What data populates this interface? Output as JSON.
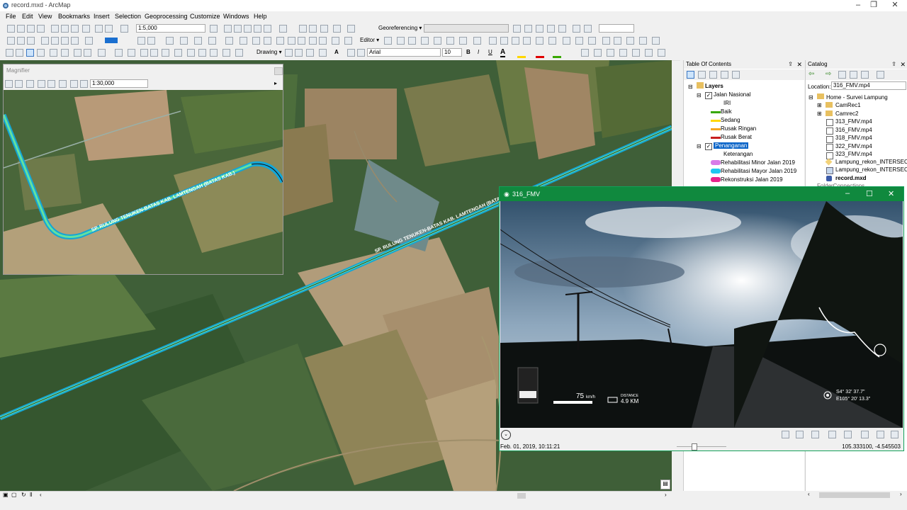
{
  "app": {
    "title": "record.mxd - ArcMap"
  },
  "menu": [
    "File",
    "Edit",
    "View",
    "Bookmarks",
    "Insert",
    "Selection",
    "Geoprocessing",
    "Customize",
    "Windows",
    "Help"
  ],
  "toolbar": {
    "scale": "1:5,000",
    "georeferencing": "Georeferencing ▾",
    "editor": "Editor ▾",
    "drawing": "Drawing ▾",
    "font": "Arial",
    "font_size": "10",
    "bold": "B",
    "italic": "I",
    "underline": "U",
    "text_tool": "A"
  },
  "magnifier": {
    "title": "Magnifier",
    "scale": "1:30,000"
  },
  "map": {
    "road_label": "SP. RULUNG TENUKEN-BATAS KAB. LAMTENGAH (BATAS KAB.)"
  },
  "toc": {
    "title": "Table Of Contents",
    "root": "Layers",
    "layer1": "Jalan Nasional",
    "layer1_field": "IRI",
    "legend1": [
      {
        "label": "Baik",
        "color": "#38a800"
      },
      {
        "label": "Sedang",
        "color": "#ffd700"
      },
      {
        "label": "Rusak Ringan",
        "color": "#f5a623"
      },
      {
        "label": "Rusak Berat",
        "color": "#c81e1e"
      }
    ],
    "layer2": "Penanganan",
    "layer2_field": "Keterangan",
    "legend2": [
      {
        "label": "Rehabilitasi Minor Jalan 2019",
        "color": "#d87be8"
      },
      {
        "label": "Rehabilitasi Mayor Jalan 2019",
        "color": "#20c8f0"
      },
      {
        "label": "Rekonstruksi Jalan 2019",
        "color": "#e8248c"
      }
    ]
  },
  "catalog": {
    "title": "Catalog",
    "location_label": "Location:",
    "location": "316_FMV.mp4",
    "root": "Home - Survei Lampung",
    "items": [
      "CamRec1",
      "Camrec2",
      "313_FMV.mp4",
      "316_FMV.mp4",
      "318_FMV.mp4",
      "322_FMV.mp4",
      "323_FMV.mp4",
      "Lampung_rekon_INTERSECT",
      "Lampung_rekon_INTERSECT",
      "record.mxd"
    ],
    "cut_item": "FolderConnections"
  },
  "fmv": {
    "title": "316_FMV",
    "speed_value": "75",
    "speed_unit": "km/h",
    "distance_label": "DISTANCE",
    "distance_value": "4.9 KM",
    "gps_lat": "S4° 32' 37.7\"",
    "gps_lon": "E105° 20' 13.3\"",
    "date": "Feb. 01, 2019, 10:11:21",
    "coords": "105.333100, -4.545503"
  }
}
